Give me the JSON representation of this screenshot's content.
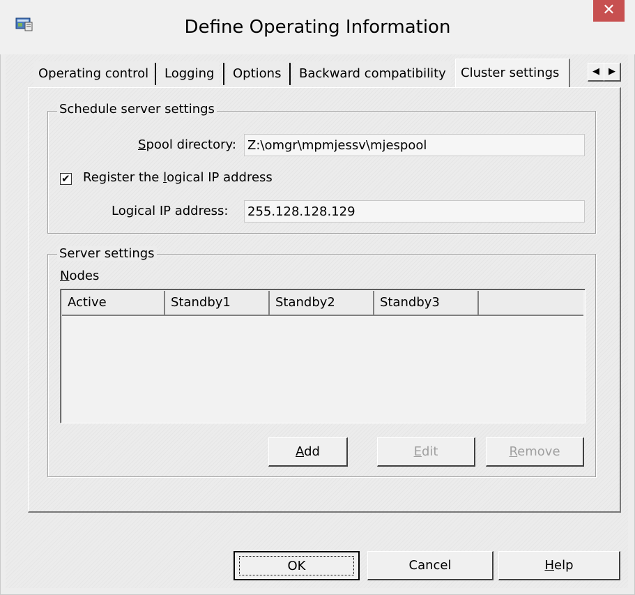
{
  "window": {
    "title": "Define Operating Information",
    "close_glyph": "✕",
    "icon": "application-icon"
  },
  "tabs": [
    {
      "label": "Operating control",
      "selected": false
    },
    {
      "label": "Logging",
      "selected": false
    },
    {
      "label": "Options",
      "selected": false
    },
    {
      "label": "Backward compatibility",
      "selected": false
    },
    {
      "label": "Cluster settings",
      "selected": true
    }
  ],
  "tab_scroll": {
    "left_glyph": "◀",
    "right_glyph": "▶"
  },
  "schedule_server": {
    "legend": "Schedule server settings",
    "spool_label_mnemonic": "S",
    "spool_label_rest": "pool directory:",
    "spool_value": "Z:\\omgr\\mpmjessv\\mjespool",
    "register_checkbox_pre": "Register the ",
    "register_checkbox_mnemonic": "l",
    "register_checkbox_post": "ogical IP address",
    "register_checked": true,
    "check_glyph": "✔",
    "ip_label_pre": "Lo",
    "ip_label_mnemonic": "g",
    "ip_label_post": "ical IP address:",
    "ip_value": "255.128.128.129"
  },
  "server_settings": {
    "legend": "Server settings",
    "nodes_label_mnemonic": "N",
    "nodes_label_rest": "odes",
    "columns": [
      "Active",
      "Standby1",
      "Standby2",
      "Standby3"
    ],
    "rows": [],
    "add_mnemonic": "A",
    "add_rest": "dd",
    "edit_mnemonic": "E",
    "edit_rest": "dit",
    "edit_enabled": false,
    "remove_mnemonic": "R",
    "remove_rest": "emove",
    "remove_enabled": false
  },
  "footer": {
    "ok_label": "OK",
    "cancel_label": "Cancel",
    "help_mnemonic": "H",
    "help_rest": "elp"
  }
}
